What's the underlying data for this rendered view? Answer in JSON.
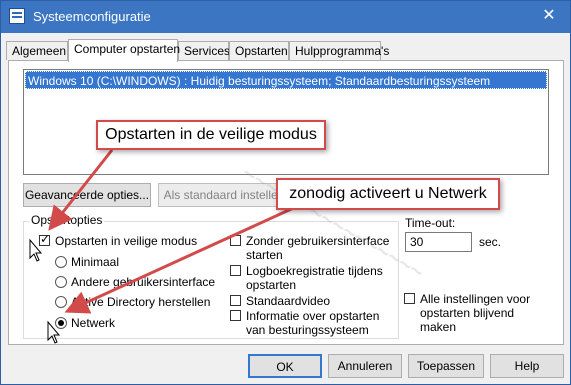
{
  "window": {
    "title": "Systeemconfiguratie",
    "close_symbol": "✕",
    "icon": "msconfig-icon"
  },
  "tabs": [
    {
      "label": "Algemeen",
      "active": false
    },
    {
      "label": "Computer opstarten",
      "active": true
    },
    {
      "label": "Services",
      "active": false
    },
    {
      "label": "Opstarten",
      "active": false
    },
    {
      "label": "Hulpprogramma's",
      "active": false
    }
  ],
  "os_list": {
    "items": [
      "Windows 10 (C:\\WINDOWS) : Huidig besturingssysteem; Standaardbesturingssysteem"
    ],
    "selected_index": 0
  },
  "buttons": {
    "advanced": "Geavanceerde opties...",
    "set_default": "Als standaard instellen",
    "ok": "OK",
    "cancel": "Annuleren",
    "apply": "Toepassen",
    "help": "Help"
  },
  "boot_options": {
    "label": "Opstartopties",
    "safe_boot": {
      "label": "Opstarten in veilige modus",
      "checked": true
    },
    "radios": [
      {
        "label": "Minimaal",
        "checked": false
      },
      {
        "label": "Andere gebruikersinterface",
        "checked": false
      },
      {
        "label": "Active Directory herstellen",
        "checked": false
      },
      {
        "label": "Netwerk",
        "checked": true
      }
    ],
    "checkboxes": [
      {
        "label": "Zonder gebruikersinterface starten",
        "checked": false
      },
      {
        "label": "Logboekregistratie tijdens opstarten",
        "checked": false
      },
      {
        "label": "Standaardvideo",
        "checked": false
      },
      {
        "label": "Informatie over opstarten van besturingssysteem",
        "checked": false
      }
    ]
  },
  "timeout": {
    "label": "Time-out:",
    "value": "30",
    "unit": "sec."
  },
  "permanent": {
    "label": "Alle instellingen voor opstarten blijvend maken",
    "checked": false
  },
  "annotations": {
    "callout1": "Opstarten in de veilige modus",
    "callout2": "zonodig activeert u Netwerk",
    "arrow_color": "#d24a4a"
  },
  "colors": {
    "titlebar": "#3c76c3",
    "selection": "#3476d0"
  }
}
